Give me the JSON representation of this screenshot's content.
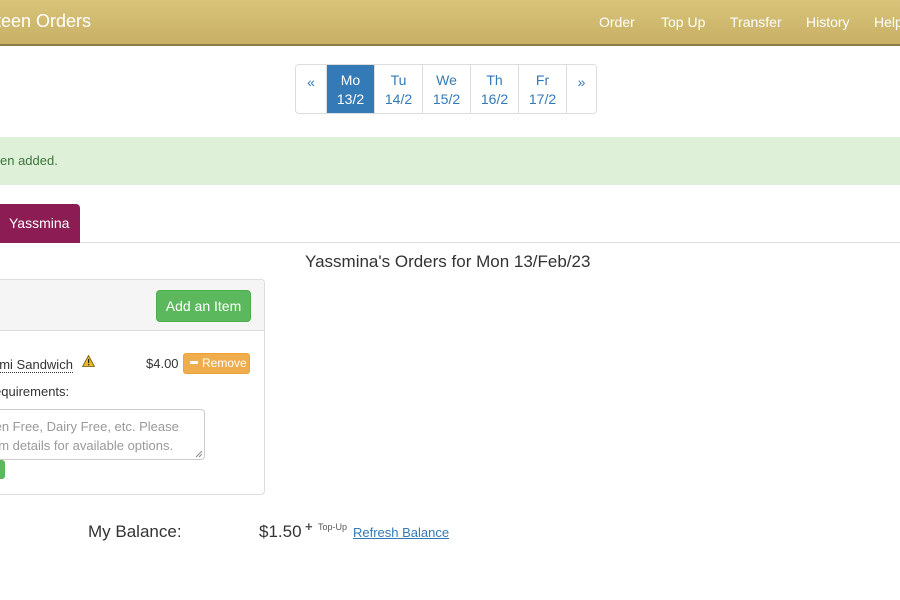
{
  "navbar": {
    "brand": "teen Orders",
    "links": [
      "Order",
      "Top Up",
      "Transfer",
      "History",
      "Help"
    ],
    "colors": {
      "background": "#c8b066",
      "text": "#ffffff"
    }
  },
  "day_pager": {
    "prev": "«",
    "next": "»",
    "days": [
      {
        "day": "Mo",
        "date": "13/2",
        "active": true
      },
      {
        "day": "Tu",
        "date": "14/2",
        "active": false
      },
      {
        "day": "We",
        "date": "15/2",
        "active": false
      },
      {
        "day": "Th",
        "date": "16/2",
        "active": false
      },
      {
        "day": "Fr",
        "date": "17/2",
        "active": false
      }
    ],
    "active_color": "#337ab7"
  },
  "alert": {
    "text": "en added.",
    "color": "#dff0d8"
  },
  "tabs": {
    "active": "Yassmina",
    "active_color": "#8b1d54"
  },
  "orders": {
    "title": "Yassmina's Orders for Mon 13/Feb/23",
    "add_button": "Add an Item",
    "items": [
      {
        "name": "ami Sandwich",
        "icon": "warning-icon",
        "price": "$4.00",
        "remove_label": "Remove"
      }
    ],
    "requirements_label": "equirements:",
    "requirements_placeholder": "ten Free, Dairy Free, etc. Please em details for available options."
  },
  "balance": {
    "label": "My Balance:",
    "value": "$1.50",
    "topup_icon": "+",
    "topup_label": "Top-Up",
    "refresh_label": "Refresh Balance"
  }
}
